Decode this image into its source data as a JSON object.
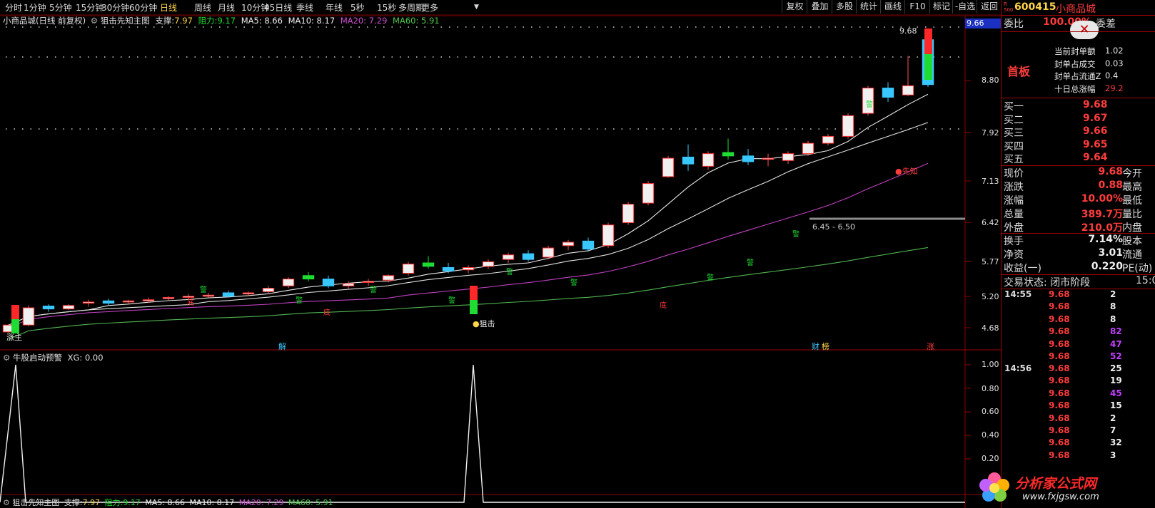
{
  "toolbar": {
    "periods": [
      "分时",
      "1分钟",
      "5分钟",
      "15分钟",
      "30分钟",
      "60分钟",
      "日线",
      "周线",
      "月线",
      "10分钟",
      "45日线",
      "季线",
      "年线",
      "5秒",
      "15秒",
      "多周期",
      "更多"
    ],
    "active": "日线",
    "right_buttons": [
      "复权",
      "叠加",
      "多股",
      "统计",
      "画线",
      "F10",
      "标记",
      "-自选",
      "返回"
    ]
  },
  "main_info": {
    "title": "小商品城(日线 前复权)",
    "indicator": "狙击先知主图",
    "support_label": "支撑:",
    "support": "7.97",
    "resist_label": "阻力:",
    "resist": "9.17",
    "ma5": "MA5: 8.66",
    "ma10": "MA10: 8.17",
    "ma20": "MA20: 7.29",
    "ma60": "MA60: 5.91"
  },
  "sub_info": {
    "name": "牛股启动预警",
    "xg": "XG: 0.00"
  },
  "bottom_info": {
    "indicator": "狙击先知主图",
    "support_label": "支撑:",
    "support": "7.97",
    "resist_label": "阻力:",
    "resist": "9.17",
    "ma5": "MA5: 8.66",
    "ma10": "MA10: 8.17",
    "ma20": "MA20: 7.29",
    "ma60": "MA60: 5.91"
  },
  "colors": {
    "up": "#ff3232",
    "down_cyan": "#38c8ff",
    "green": "#1edc32",
    "ma20": "#c040c0",
    "ma60": "#50b450",
    "yellow": "#ffd54a"
  },
  "chart_data": [
    {
      "type": "candlestick",
      "y_ticks": [
        "8.80",
        "7.92",
        "7.13",
        "6.42",
        "5.77",
        "5.20",
        "4.68"
      ],
      "price_tag": "9.66",
      "high_label": "9.68",
      "range_label": "6.45 - 6.50",
      "markers": {
        "warn": "警",
        "sniper": "狙击",
        "prophet": "先知",
        "bottom": "底",
        "main": "涨主"
      },
      "events": {
        "jie": "解",
        "cai": "财",
        "bang": "榜",
        "zhang": "涨"
      },
      "lim_y": [
        4.45,
        9.9
      ],
      "candles": [
        [
          4.6,
          4.74,
          4.58,
          4.72
        ],
        [
          4.72,
          5.06,
          4.7,
          5.02
        ],
        [
          5.05,
          5.08,
          4.95,
          5.0
        ],
        [
          5.0,
          5.08,
          4.98,
          5.06
        ],
        [
          5.1,
          5.16,
          5.04,
          5.12
        ],
        [
          5.14,
          5.18,
          5.06,
          5.1
        ],
        [
          5.12,
          5.16,
          5.08,
          5.14
        ],
        [
          5.14,
          5.2,
          5.1,
          5.16
        ],
        [
          5.18,
          5.22,
          5.14,
          5.2
        ],
        [
          5.2,
          5.26,
          5.16,
          5.22
        ],
        [
          5.22,
          5.28,
          5.18,
          5.24
        ],
        [
          5.28,
          5.32,
          5.2,
          5.22
        ],
        [
          5.26,
          5.3,
          5.22,
          5.28
        ],
        [
          5.3,
          5.4,
          5.26,
          5.36
        ],
        [
          5.4,
          5.55,
          5.36,
          5.52
        ],
        [
          5.58,
          5.64,
          5.48,
          5.52
        ],
        [
          5.52,
          5.58,
          5.36,
          5.4
        ],
        [
          5.4,
          5.48,
          5.34,
          5.44
        ],
        [
          5.46,
          5.52,
          5.4,
          5.48
        ],
        [
          5.5,
          5.6,
          5.46,
          5.58
        ],
        [
          5.62,
          5.82,
          5.58,
          5.78
        ],
        [
          5.8,
          5.92,
          5.7,
          5.74
        ],
        [
          5.72,
          5.8,
          5.62,
          5.66
        ],
        [
          5.68,
          5.76,
          5.62,
          5.72
        ],
        [
          5.74,
          5.86,
          5.7,
          5.82
        ],
        [
          5.86,
          5.98,
          5.8,
          5.94
        ],
        [
          5.96,
          6.02,
          5.82,
          5.86
        ],
        [
          5.9,
          6.1,
          5.86,
          6.06
        ],
        [
          6.1,
          6.2,
          6.02,
          6.16
        ],
        [
          6.18,
          6.24,
          6.0,
          6.04
        ],
        [
          6.1,
          6.5,
          6.06,
          6.46
        ],
        [
          6.5,
          6.86,
          6.46,
          6.82
        ],
        [
          6.84,
          7.22,
          6.8,
          7.18
        ],
        [
          7.3,
          7.66,
          7.28,
          7.62
        ],
        [
          7.64,
          7.86,
          7.4,
          7.52
        ],
        [
          7.48,
          7.74,
          7.42,
          7.7
        ],
        [
          7.72,
          7.96,
          7.6,
          7.66
        ],
        [
          7.66,
          7.78,
          7.5,
          7.56
        ],
        [
          7.6,
          7.7,
          7.48,
          7.62
        ],
        [
          7.58,
          7.74,
          7.52,
          7.7
        ],
        [
          7.7,
          7.92,
          7.66,
          7.88
        ],
        [
          7.88,
          8.04,
          7.84,
          8.0
        ],
        [
          8.0,
          8.4,
          7.96,
          8.36
        ],
        [
          8.4,
          8.88,
          8.36,
          8.84
        ],
        [
          8.84,
          8.94,
          8.6,
          8.68
        ],
        [
          8.72,
          9.4,
          8.7,
          8.88
        ],
        [
          9.68,
          9.7,
          8.86,
          8.9
        ]
      ]
    },
    {
      "type": "line",
      "y_ticks": [
        "1.00",
        "0.80",
        "0.60",
        "0.40",
        "0.20"
      ],
      "lim_y": [
        0,
        1.0
      ]
    }
  ],
  "right_panel": {
    "code_prefix_top": "R",
    "code_prefix_bottom": "500",
    "code": "600415",
    "name": "小商品城",
    "wb_label": "委比",
    "wb_value": "100.00%",
    "wc_label": "委差",
    "sealed_items": [
      {
        "label": "当前封单额",
        "value": "1.02"
      },
      {
        "label": "封单占成交",
        "value": "0.03"
      },
      {
        "label": "封单占流通Z",
        "value": "0.4"
      },
      {
        "label": "十日总涨幅",
        "value": "29.2"
      }
    ],
    "first_board": "首板",
    "bids": [
      {
        "label": "买一",
        "price": "9.68"
      },
      {
        "label": "买二",
        "price": "9.67"
      },
      {
        "label": "买三",
        "price": "9.66"
      },
      {
        "label": "买四",
        "price": "9.65"
      },
      {
        "label": "买五",
        "price": "9.64"
      }
    ],
    "quote": [
      {
        "label": "现价",
        "value": "9.68",
        "tail": "今开"
      },
      {
        "label": "涨跌",
        "value": "0.88",
        "tail": "最高"
      },
      {
        "label": "涨幅",
        "value": "10.00%",
        "tail": "最低"
      },
      {
        "label": "总量",
        "value": "389.7万",
        "tail": "量比"
      },
      {
        "label": "外盘",
        "value": "210.0万",
        "tail": "内盘"
      }
    ],
    "stats": [
      {
        "label": "换手",
        "value": "7.14%",
        "tail": "股本"
      },
      {
        "label": "净资",
        "value": "3.01",
        "tail": "流通"
      },
      {
        "label": "收益(一)",
        "value": "0.220",
        "tail": "PE(动)"
      }
    ],
    "status": "交易状态: 闭市阶段",
    "status_time": "15:0",
    "ticks": [
      {
        "time": "14:55",
        "price": "9.68",
        "vol": "2"
      },
      {
        "time": "",
        "price": "9.68",
        "vol": "8"
      },
      {
        "time": "",
        "price": "9.68",
        "vol": "8"
      },
      {
        "time": "",
        "price": "9.68",
        "vol": "82"
      },
      {
        "time": "",
        "price": "9.68",
        "vol": "47"
      },
      {
        "time": "",
        "price": "9.68",
        "vol": "52"
      },
      {
        "time": "14:56",
        "price": "9.68",
        "vol": "25"
      },
      {
        "time": "",
        "price": "9.68",
        "vol": "19"
      },
      {
        "time": "",
        "price": "9.68",
        "vol": "45"
      },
      {
        "time": "",
        "price": "9.68",
        "vol": "15"
      },
      {
        "time": "",
        "price": "9.68",
        "vol": "2"
      },
      {
        "time": "",
        "price": "9.68",
        "vol": "7"
      },
      {
        "time": "",
        "price": "9.68",
        "vol": "32"
      },
      {
        "time": "",
        "price": "9.68",
        "vol": "3"
      }
    ]
  },
  "watermark": {
    "title": "分析家公式网",
    "url": "www.fxjgsw.com"
  }
}
